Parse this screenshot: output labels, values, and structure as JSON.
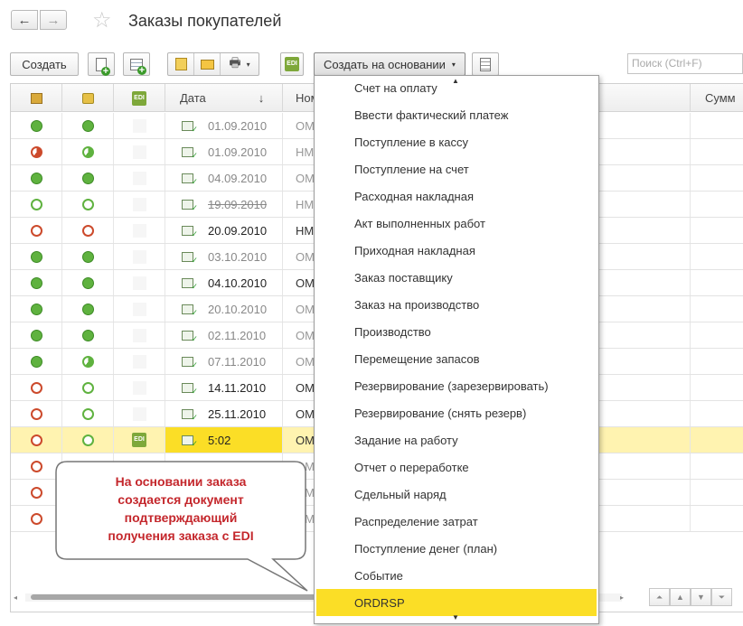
{
  "header": {
    "title": "Заказы покупателей",
    "back_icon": "arrow-left-icon",
    "forward_icon": "arrow-right-icon",
    "favorite_icon": "star-icon"
  },
  "toolbar": {
    "create_label": "Создать",
    "edi_label": "EDI",
    "create_based_label": "Создать на основании",
    "search_placeholder": "Поиск (Ctrl+F)"
  },
  "grid": {
    "columns": {
      "date": "Дата",
      "sort": "↓",
      "number": "Ном",
      "sum": "Сумм"
    },
    "rows": [
      {
        "s1": "full",
        "s2": "full",
        "date": "01.09.2010",
        "num": "ОМ",
        "bold": false,
        "strike": false
      },
      {
        "s1": "redpart",
        "s2": "greenpart",
        "date": "01.09.2010",
        "num": "НМ",
        "bold": false,
        "strike": false
      },
      {
        "s1": "full",
        "s2": "full",
        "date": "04.09.2010",
        "num": "ОМ",
        "bold": false,
        "strike": false
      },
      {
        "s1": "empty",
        "s2": "empty",
        "date": "19.09.2010",
        "num": "НМ",
        "bold": false,
        "strike": true
      },
      {
        "s1": "red",
        "s2": "red",
        "date": "20.09.2010",
        "num": "НМ",
        "bold": true,
        "strike": false
      },
      {
        "s1": "full",
        "s2": "full",
        "date": "03.10.2010",
        "num": "ОМ",
        "bold": false,
        "strike": false
      },
      {
        "s1": "full",
        "s2": "full",
        "date": "04.10.2010",
        "num": "ОМ",
        "bold": true,
        "strike": false
      },
      {
        "s1": "full",
        "s2": "full",
        "date": "20.10.2010",
        "num": "ОМ",
        "bold": false,
        "strike": false
      },
      {
        "s1": "full",
        "s2": "full",
        "date": "02.11.2010",
        "num": "ОМ",
        "bold": false,
        "strike": false
      },
      {
        "s1": "full",
        "s2": "greenpart",
        "date": "07.11.2010",
        "num": "ОМ",
        "bold": false,
        "strike": false
      },
      {
        "s1": "red",
        "s2": "empty",
        "date": "14.11.2010",
        "num": "ОМ",
        "bold": true,
        "strike": false
      },
      {
        "s1": "red",
        "s2": "empty",
        "date": "25.11.2010",
        "num": "ОМ",
        "bold": true,
        "strike": false
      },
      {
        "s1": "red",
        "s2": "empty",
        "date": "5:02",
        "num": "ОМ",
        "bold": false,
        "strike": false,
        "selected": true,
        "edi": "EDI"
      },
      {
        "s1": "red",
        "s2": "",
        "date": "",
        "num": "ОМ",
        "bold": false,
        "strike": false
      },
      {
        "s1": "red",
        "s2": "",
        "date": "",
        "num": "ОМ",
        "bold": false,
        "strike": false
      },
      {
        "s1": "red",
        "s2": "",
        "date": "",
        "num": "ОМ",
        "bold": false,
        "strike": false
      }
    ]
  },
  "menu": {
    "items": [
      "Счет на оплату",
      "Ввести фактический платеж",
      "Поступление в кассу",
      "Поступление на счет",
      "Расходная накладная",
      "Акт выполненных работ",
      "Приходная накладная",
      "Заказ поставщику",
      "Заказ на производство",
      "Производство",
      "Перемещение запасов",
      "Резервирование (зарезервировать)",
      "Резервирование (снять резерв)",
      "Задание на работу",
      "Отчет о переработке",
      "Сдельный наряд",
      "Распределение затрат",
      "Поступление денег (план)",
      "Событие",
      "ORDRSP"
    ],
    "active_index": 19
  },
  "callout": {
    "lines": [
      "На основании заказа",
      "создается документ",
      "подтверждающий",
      "получения заказа с EDI"
    ]
  },
  "colors": {
    "accent_yellow": "#fbde26",
    "selected_row": "#fff3b0",
    "status_green": "#5fb23f",
    "status_red": "#cc4a2c",
    "callout_text": "#c4272c"
  }
}
